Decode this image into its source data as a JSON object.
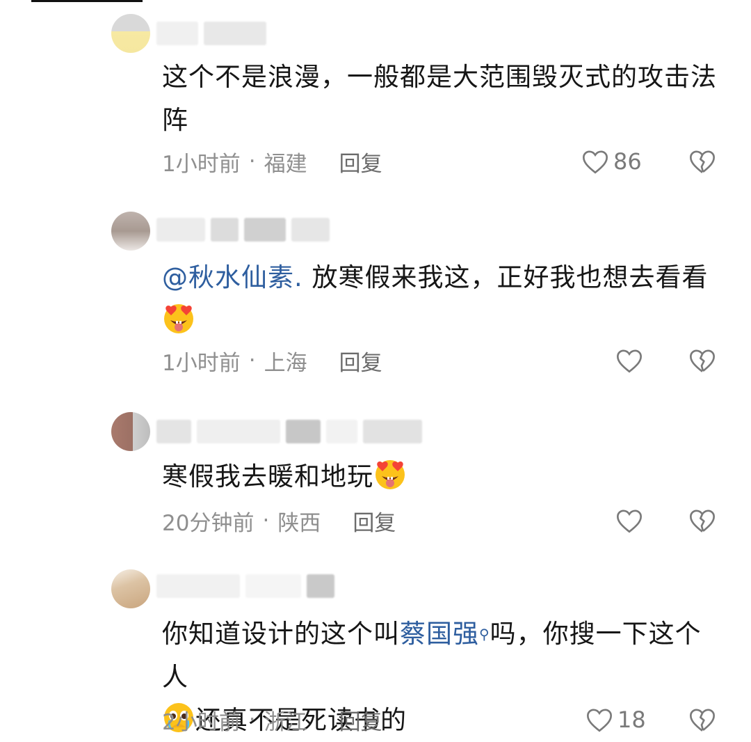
{
  "comments": [
    {
      "text": "这个不是浪漫，一般都是大范围毁灭式的攻击法阵",
      "time": "1小时前",
      "location": "福建",
      "reply": "回复",
      "likes": "86"
    },
    {
      "mention": "@秋水仙素.",
      "text": " 放寒假来我这，正好我也想去看看",
      "emoji": "heart-eyes-tongue-emoji",
      "time": "1小时前",
      "location": "上海",
      "reply": "回复",
      "likes": ""
    },
    {
      "text": "寒假我去暖和地玩",
      "emoji": "heart-eyes-tongue-emoji",
      "time": "20分钟前",
      "location": "陕西",
      "reply": "回复",
      "likes": ""
    },
    {
      "text_a": "你知道设计的这个叫",
      "link": "蔡国强",
      "text_b": "吗，你搜一下这个人",
      "text_c": "还真不是死读书的",
      "emoji": "pleading-tearful-emoji",
      "time": "2小时前",
      "location": "浙江",
      "reply": "回复",
      "likes": "18"
    }
  ],
  "icons": {
    "like": "heart-outline-icon",
    "dislike": "broken-heart-icon"
  },
  "colors": {
    "link": "#2e5e9f",
    "meta": "#8f8f8f",
    "text": "#161616"
  }
}
